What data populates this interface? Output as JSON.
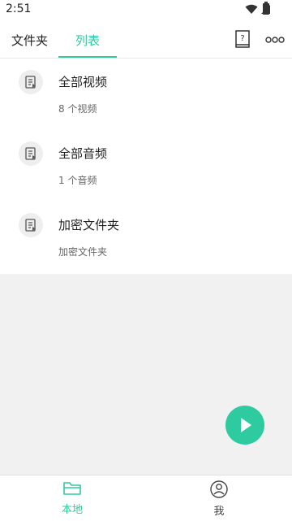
{
  "status": {
    "time": "2:51"
  },
  "tabs": [
    {
      "label": "文件夹"
    },
    {
      "label": "列表"
    }
  ],
  "items": [
    {
      "title": "全部视频",
      "subtitle": "8 个视频"
    },
    {
      "title": "全部音频",
      "subtitle": "1 个音频"
    },
    {
      "title": "加密文件夹",
      "subtitle": "加密文件夹"
    }
  ],
  "nav": [
    {
      "label": "本地"
    },
    {
      "label": "我"
    }
  ],
  "colors": {
    "accent": "#2ecba1",
    "empty_bg": "#f1f1f1"
  },
  "icons": [
    "wifi-icon",
    "signal-icon",
    "battery-icon",
    "help-book-icon",
    "more-icon",
    "list-doc-icon",
    "play-icon",
    "folder-icon",
    "person-icon"
  ]
}
